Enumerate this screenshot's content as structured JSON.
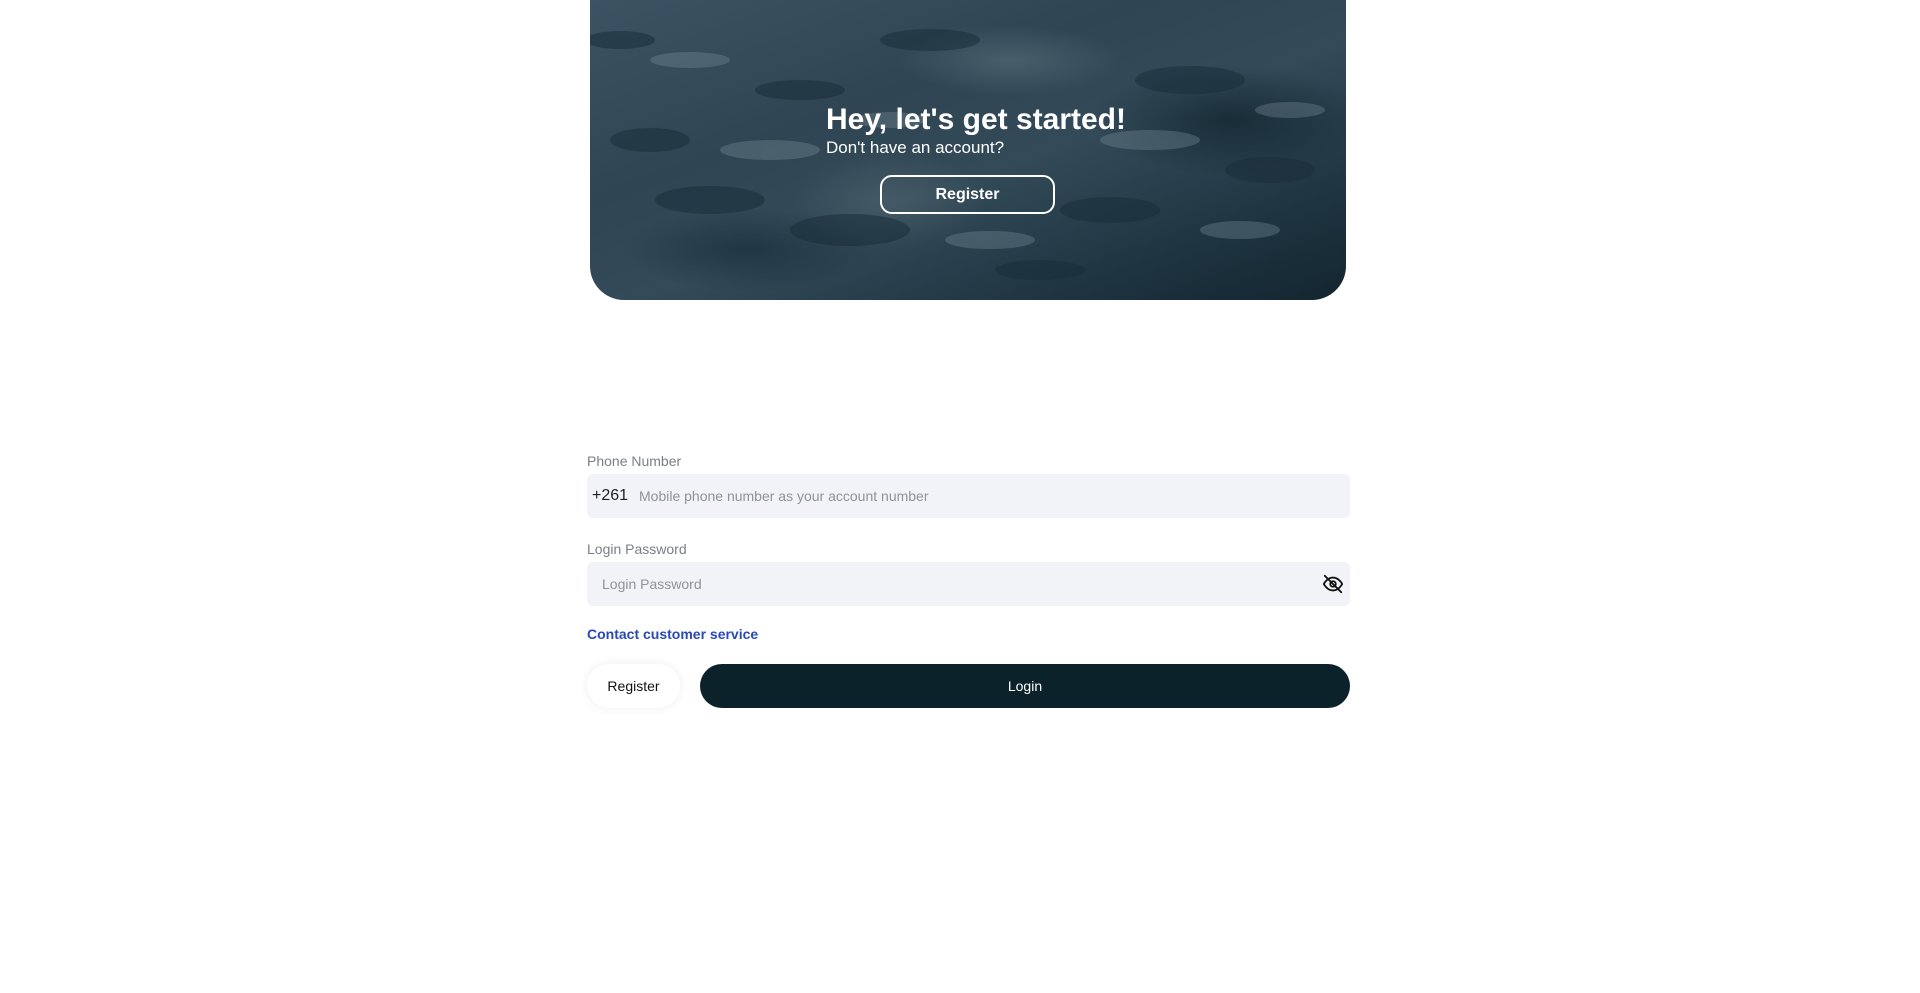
{
  "hero": {
    "title": "Hey, let's get started!",
    "subtitle": "Don't have an account?",
    "register_label": "Register"
  },
  "form": {
    "phone": {
      "label": "Phone Number",
      "prefix": "+261",
      "placeholder": "Mobile phone number as your account number",
      "value": ""
    },
    "password": {
      "label": "Login Password",
      "placeholder": "Login Password",
      "value": "",
      "toggle_icon": "eye-off-icon"
    },
    "contact_label": "Contact customer service",
    "register_label": "Register",
    "login_label": "Login"
  },
  "colors": {
    "primary_button": "#0c222a",
    "link": "#2a49b8",
    "input_bg": "#f1f3f8"
  }
}
